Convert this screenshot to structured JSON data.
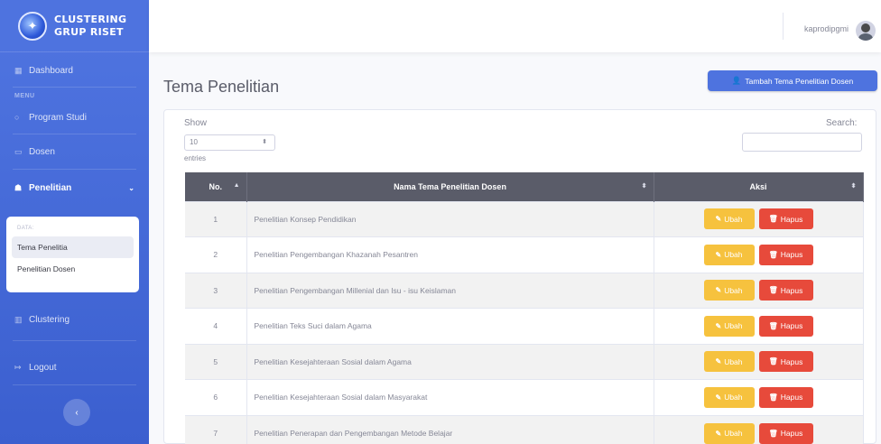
{
  "brand": {
    "line1": "CLUSTERING",
    "line2": "GRUP RISET"
  },
  "sidebar": {
    "dashboard": "Dashboard",
    "menu_heading": "MENU",
    "program_studi": "Program Studi",
    "dosen": "Dosen",
    "penelitian": "Penelitian",
    "submenu_heading": "DATA:",
    "submenu_items": [
      "Tema Penelitia",
      "Penelitian Dosen"
    ],
    "clustering": "Clustering",
    "logout": "Logout"
  },
  "topbar": {
    "user_name": "kaprodipgmi"
  },
  "page": {
    "title": "Tema Penelitian",
    "add_button": "Tambah Tema Penelitian Dosen"
  },
  "datatable": {
    "show_label": "Show",
    "length_value": "10",
    "entries_label": "entries",
    "search_label": "Search:",
    "columns": [
      "No.",
      "Nama Tema Penelitian Dosen",
      "Aksi"
    ],
    "edit_label": "Ubah",
    "delete_label": "Hapus",
    "rows": [
      {
        "no": "1",
        "name": "Penelitian Konsep Pendidikan"
      },
      {
        "no": "2",
        "name": "Penelitian Pengembangan Khazanah Pesantren"
      },
      {
        "no": "3",
        "name": "Penelitian Pengembangan Millenial dan Isu - isu Keislaman"
      },
      {
        "no": "4",
        "name": "Penelitian Teks Suci dalam Agama"
      },
      {
        "no": "5",
        "name": "Penelitian Kesejahteraan Sosial dalam Agama"
      },
      {
        "no": "6",
        "name": "Penelitian Kesejahteraan Sosial dalam Masyarakat"
      },
      {
        "no": "7",
        "name": "Penelitian Penerapan dan Pengembangan Metode Belajar"
      }
    ]
  },
  "colors": {
    "primary": "#4e73df",
    "warning": "#f6c23e",
    "danger": "#e74a3b",
    "table_header": "#5a5c69"
  }
}
